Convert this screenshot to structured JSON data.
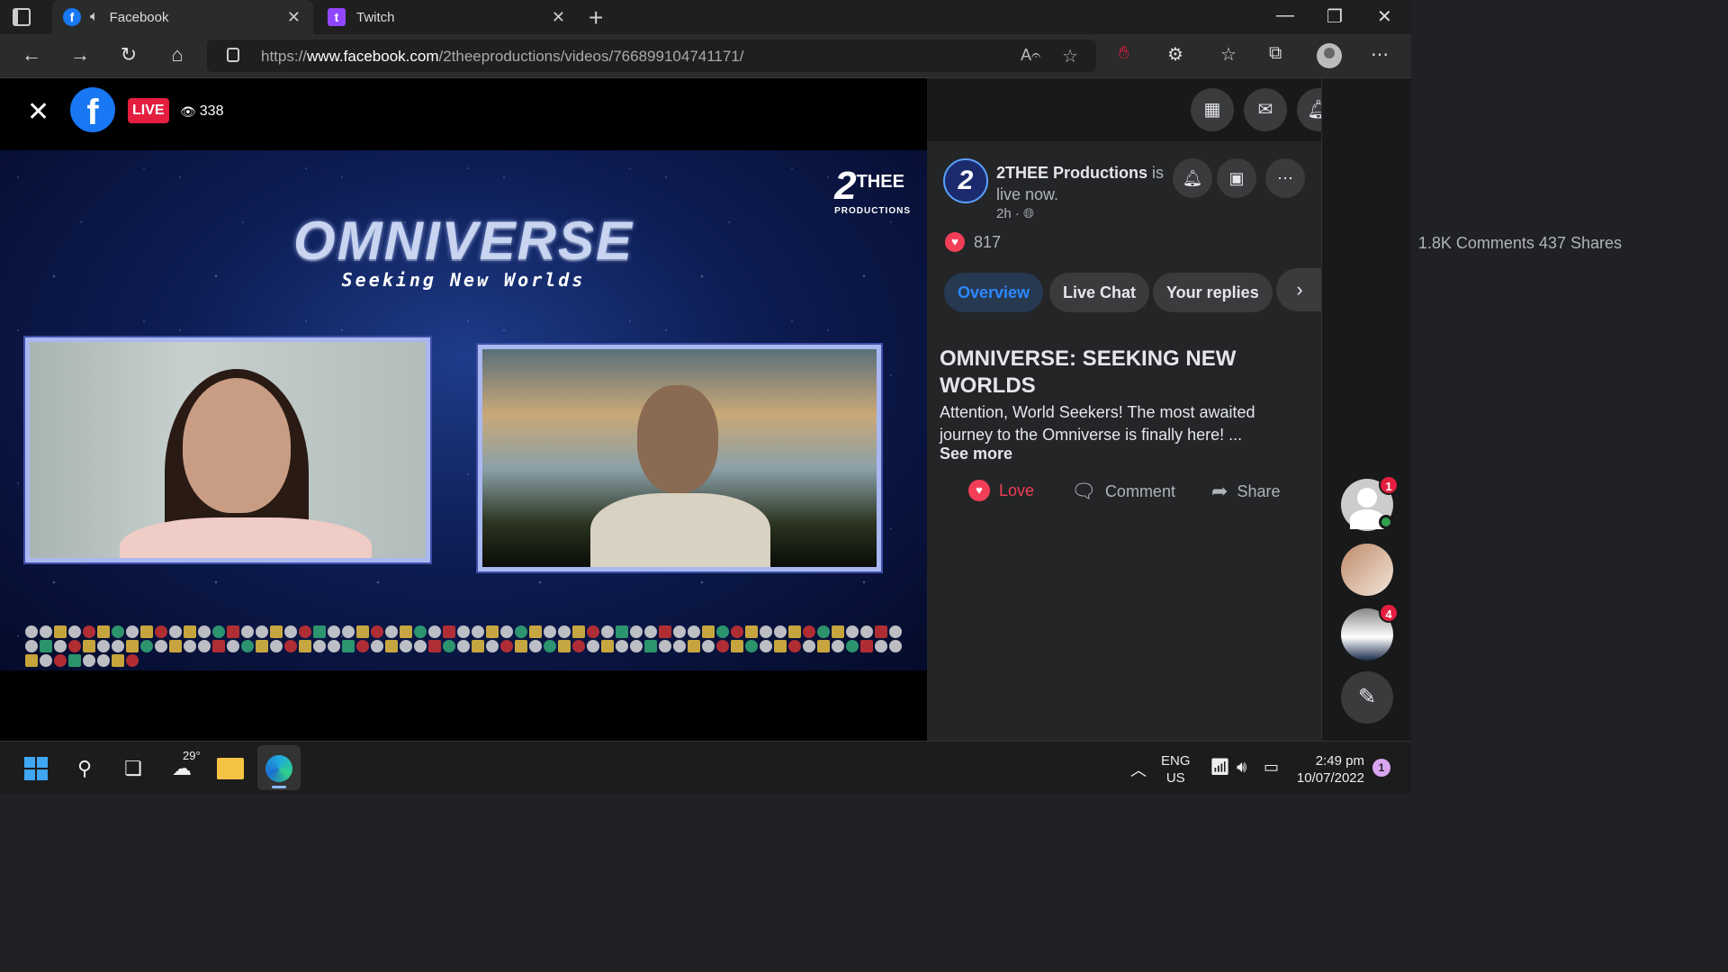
{
  "browser": {
    "tabs": [
      {
        "label": "Facebook",
        "favicon": "facebook-icon",
        "audio": true
      },
      {
        "label": "Twitch",
        "favicon": "twitch-icon"
      }
    ],
    "url_prefix": "https://",
    "url_domain": "www.facebook.com",
    "url_path": "/2theeproductions/videos/766899104741171/"
  },
  "video": {
    "live_label": "LIVE",
    "viewer_count": "338",
    "stream_title": "OMNIVERSE",
    "stream_subtitle": "Seeking New Worlds",
    "brand_mark": "2",
    "brand_name": "THEE",
    "brand_sub": "PRODUCTIONS"
  },
  "post": {
    "page_avatar_letter": "2",
    "page_name": "2THEE Productions",
    "status": " is live now.",
    "time": "2h · ",
    "reaction_count": "817",
    "comments": "1.8K Comments",
    "shares": "437 Shares",
    "tabs": [
      "Overview",
      "Live Chat",
      "Your replies"
    ],
    "title": "OMNIVERSE: SEEKING NEW WORLDS",
    "body": "Attention, World Seekers! The most awaited journey to the Omniverse is finally here! ...",
    "see_more": "See more",
    "actions": {
      "love": "Love",
      "comment": "Comment",
      "share": "Share"
    }
  },
  "contacts": {
    "badge_1": "1",
    "badge_3": "4"
  },
  "taskbar": {
    "temperature": "29°",
    "lang_top": "ENG",
    "lang_bottom": "US",
    "time": "2:49 pm",
    "date": "10/07/2022",
    "notifications": "1"
  },
  "colors": {
    "facebook_blue": "#1877f2",
    "live_red": "#e41e3f",
    "love_red": "#f33e58",
    "tab_active_text": "#2d88ff"
  }
}
